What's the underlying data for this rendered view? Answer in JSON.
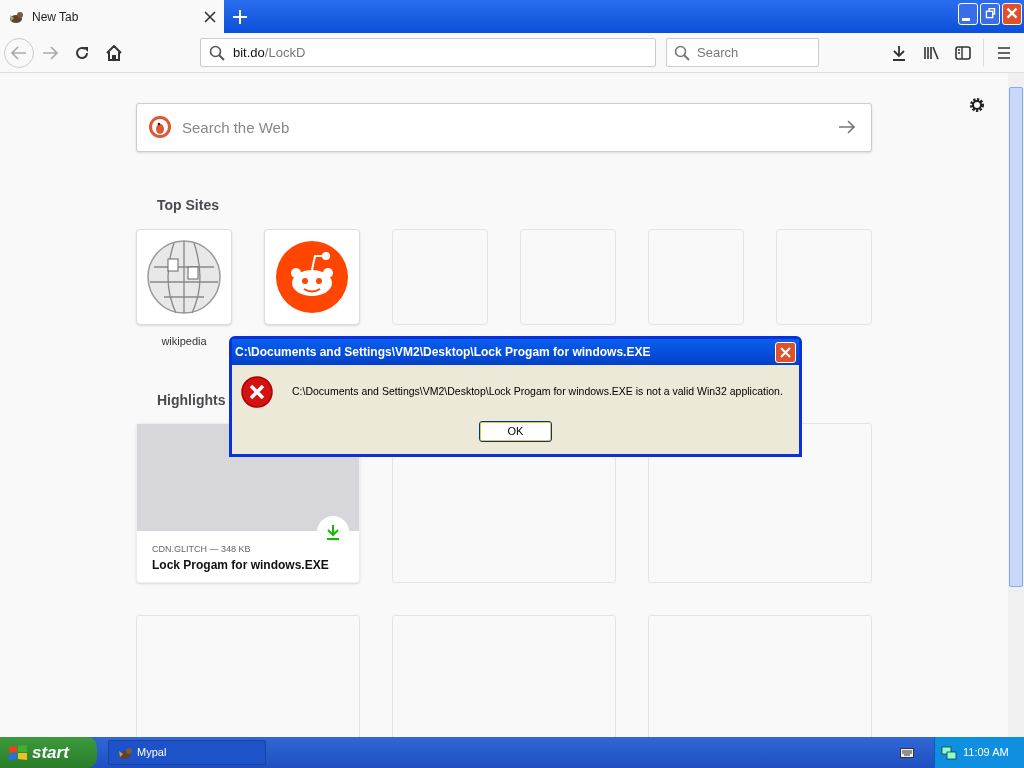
{
  "browser_tab": {
    "title": "New Tab",
    "selected": true
  },
  "address_bar": {
    "domain": "bit.do",
    "path": "/LockD"
  },
  "search_bar": {
    "placeholder": "Search"
  },
  "page": {
    "search": {
      "placeholder": "Search the Web"
    },
    "top_sites": {
      "heading": "Top Sites",
      "sites": [
        {
          "kind": "wikipedia",
          "label": "wikipedia"
        },
        {
          "kind": "reddit"
        },
        {
          "kind": "empty"
        },
        {
          "kind": "empty"
        },
        {
          "kind": "empty"
        },
        {
          "kind": "empty"
        }
      ]
    },
    "highlights": {
      "heading": "Highlights",
      "cards": [
        {
          "kind": "download",
          "source": "CDN.GLITCH — 348 KB",
          "title": "Lock Progam for windows.EXE"
        },
        {
          "kind": "empty"
        },
        {
          "kind": "empty"
        },
        {
          "kind": "empty"
        },
        {
          "kind": "empty"
        },
        {
          "kind": "empty"
        }
      ]
    }
  },
  "dialog": {
    "title": "C:\\Documents and Settings\\VM2\\Desktop\\Lock Progam for windows.EXE",
    "message": "C:\\Documents and Settings\\VM2\\Desktop\\Lock Progam for windows.EXE is not a valid Win32 application.",
    "button": "OK"
  },
  "taskbar": {
    "start": "start",
    "tasks": [
      {
        "label": "Mypal"
      }
    ],
    "clock": "11:09 AM"
  }
}
